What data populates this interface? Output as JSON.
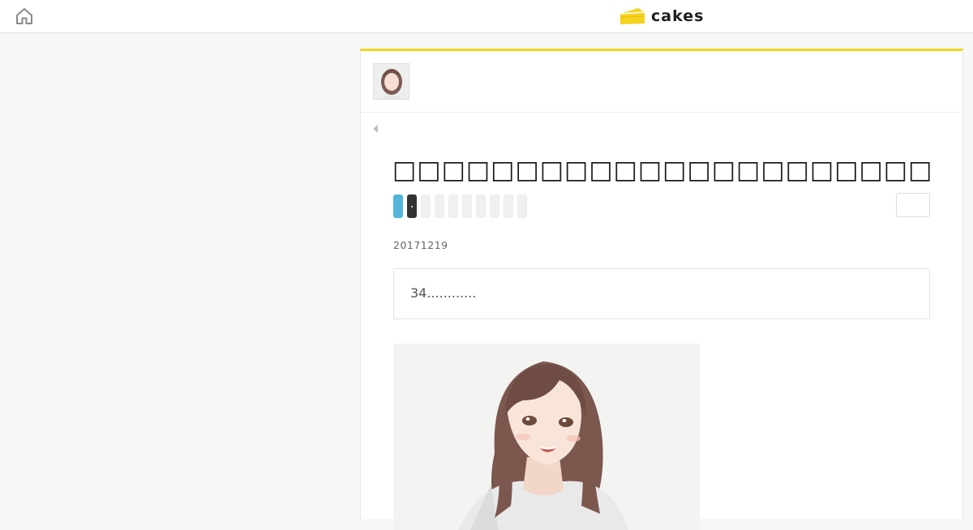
{
  "header": {
    "home_icon": "home-icon",
    "logo_icon": "cake-slice-icon",
    "logo_text": "cakes",
    "brand_color": "#f5d21c"
  },
  "article": {
    "author_avatar": "author-avatar-illustration",
    "back_icon": "caret-left-icon",
    "title": "□□□□□□□□□□□□□□□□□□□□□□",
    "share_buttons": [
      {
        "name": "twitter-share",
        "color": "#55b4da"
      },
      {
        "name": "note-share",
        "color": "#333333"
      },
      {
        "name": "share-3",
        "color": "#f0f0f0"
      },
      {
        "name": "share-4",
        "color": "#f0f0f0"
      },
      {
        "name": "share-5",
        "color": "#f0f0f0"
      },
      {
        "name": "share-6",
        "color": "#f0f0f0"
      },
      {
        "name": "share-7",
        "color": "#f0f0f0"
      },
      {
        "name": "share-8",
        "color": "#f0f0f0"
      },
      {
        "name": "share-9",
        "color": "#f0f0f0"
      },
      {
        "name": "share-10",
        "color": "#f0f0f0"
      }
    ],
    "date": "20171219",
    "summary": "34............",
    "hero_image": "illustration-smiling-woman-brown-hair"
  }
}
